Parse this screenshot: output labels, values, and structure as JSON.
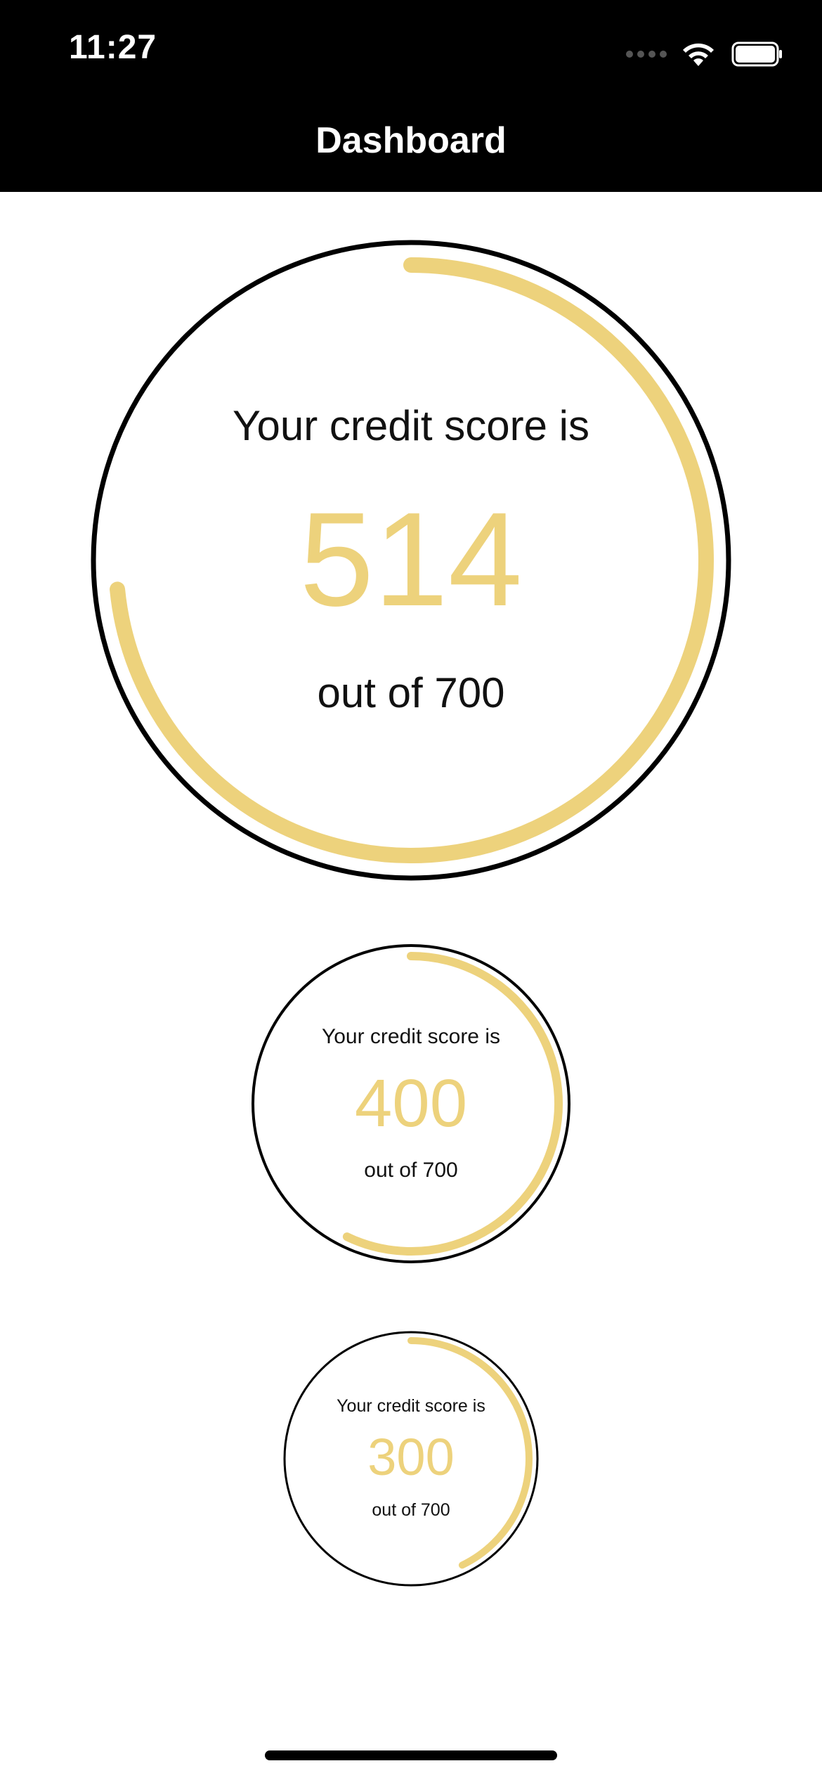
{
  "status_bar": {
    "time": "11:27",
    "icons": [
      "cellular-signal-icon",
      "wifi-icon",
      "battery-icon"
    ]
  },
  "nav": {
    "title": "Dashboard"
  },
  "colors": {
    "header_bg": "#000000",
    "accent": "#EDD27C",
    "ring": "#000000",
    "text": "#111111"
  },
  "gauges": [
    {
      "title": "Your credit score is",
      "score": "514",
      "subtitle": "out of 700",
      "score_value": 514,
      "max_value": 700
    },
    {
      "title": "Your credit score is",
      "score": "400",
      "subtitle": "out of 700",
      "score_value": 400,
      "max_value": 700
    },
    {
      "title": "Your credit score is",
      "score": "300",
      "subtitle": "out of 700",
      "score_value": 300,
      "max_value": 700
    }
  ]
}
